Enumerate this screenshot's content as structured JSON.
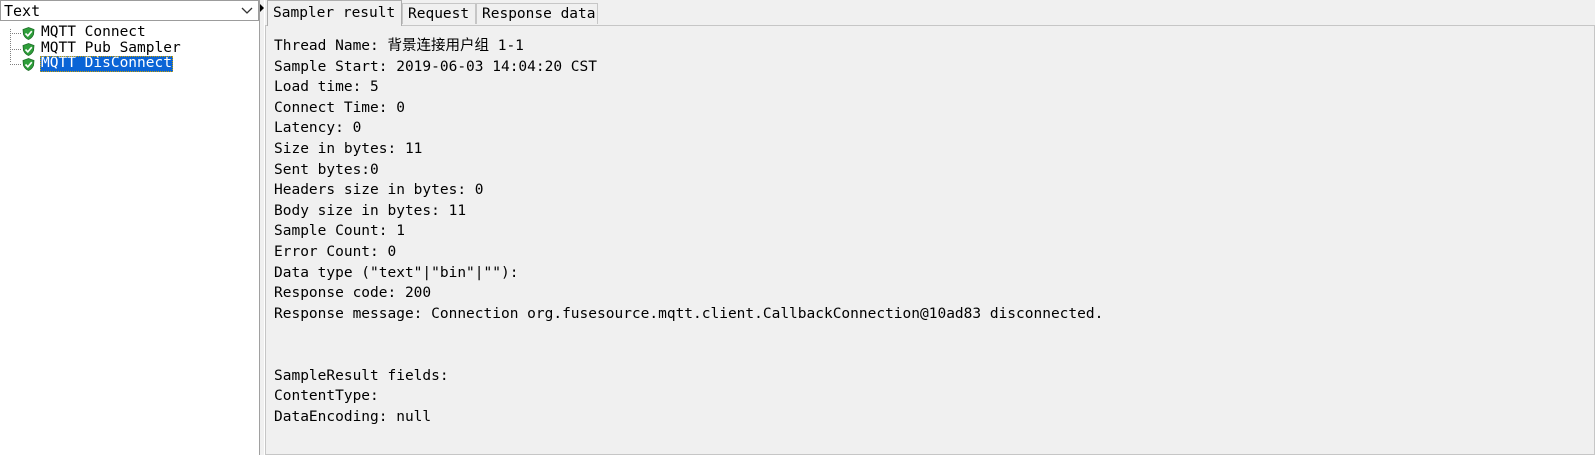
{
  "renderer": {
    "selected": "Text"
  },
  "tree": {
    "items": [
      {
        "label": "MQTT Connect",
        "status": "success",
        "selected": false
      },
      {
        "label": "MQTT Pub Sampler",
        "status": "success",
        "selected": false
      },
      {
        "label": "MQTT DisConnect",
        "status": "success",
        "selected": true
      }
    ]
  },
  "tabs": {
    "sampler_result": "Sampler result",
    "request": "Request",
    "response_data": "Response data",
    "active": "sampler_result"
  },
  "sampler_result": {
    "lines": [
      "Thread Name: 背景连接用户组 1-1",
      "Sample Start: 2019-06-03 14:04:20 CST",
      "Load time: 5",
      "Connect Time: 0",
      "Latency: 0",
      "Size in bytes: 11",
      "Sent bytes:0",
      "Headers size in bytes: 0",
      "Body size in bytes: 11",
      "Sample Count: 1",
      "Error Count: 0",
      "Data type (\"text\"|\"bin\"|\"\"):",
      "Response code: 200",
      "Response message: Connection org.fusesource.mqtt.client.CallbackConnection@10ad83 disconnected.",
      "",
      "",
      "SampleResult fields:",
      "ContentType:",
      "DataEncoding: null"
    ]
  },
  "colors": {
    "selection": "#0a64d6",
    "success_icon": "#2e9e3a"
  },
  "icons": {
    "renderer_dropdown": "chevron-down-icon",
    "tree_status": "success-shield-icon"
  }
}
